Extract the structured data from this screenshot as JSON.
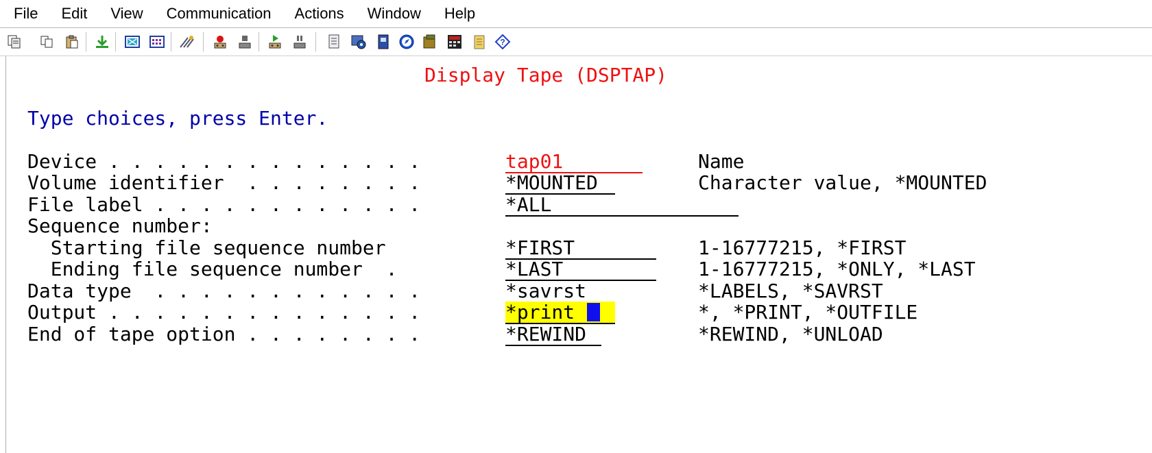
{
  "menubar": {
    "items": [
      "File",
      "Edit",
      "View",
      "Communication",
      "Actions",
      "Window",
      "Help"
    ]
  },
  "toolbar": {
    "icons": [
      "copy-screen-icon",
      "copy-icon",
      "paste-icon",
      "download-icon",
      "display-icon",
      "keypad-icon",
      "macro-icon",
      "record-macro-icon",
      "stop-macro-icon",
      "play-macro-icon",
      "pause-macro-icon",
      "notes-icon",
      "settings-icon",
      "print-icon",
      "navigator-icon",
      "transfer-icon",
      "sql-icon",
      "clipboard-icon",
      "help-icon"
    ]
  },
  "screen": {
    "title": "Display Tape (DSPTAP)",
    "instruction": "Type choices, press Enter.",
    "rows": [
      {
        "label": "Device . . . . . . . . . . . . . .",
        "value": "tap01",
        "hint": "Name"
      },
      {
        "label": "Volume identifier  . . . . . . . .",
        "value": "*MOUNTED",
        "hint": "Character value, *MOUNTED"
      },
      {
        "label": "File label . . . . . . . . . . . .",
        "value": "*ALL",
        "hint": ""
      },
      {
        "label": "Sequence number:",
        "value": "",
        "hint": ""
      },
      {
        "label": "  Starting file sequence number",
        "value": "*FIRST",
        "hint": "1-16777215, *FIRST"
      },
      {
        "label": "  Ending file sequence number  .",
        "value": "*LAST",
        "hint": "1-16777215, *ONLY, *LAST"
      },
      {
        "label": "Data type  . . . . . . . . . . . .",
        "value": "*savrst",
        "hint": "*LABELS, *SAVRST"
      },
      {
        "label": "Output . . . . . . . . . . . . . .",
        "value": "*print",
        "hint": "*, *PRINT, *OUTFILE"
      },
      {
        "label": "End of tape option . . . . . . . .",
        "value": "*REWIND",
        "hint": "*REWIND, *UNLOAD"
      }
    ]
  },
  "colors": {
    "title": "#ee1111",
    "instruction": "#0000aa",
    "highlight": "#ffff00",
    "cursor": "#1010ee"
  }
}
